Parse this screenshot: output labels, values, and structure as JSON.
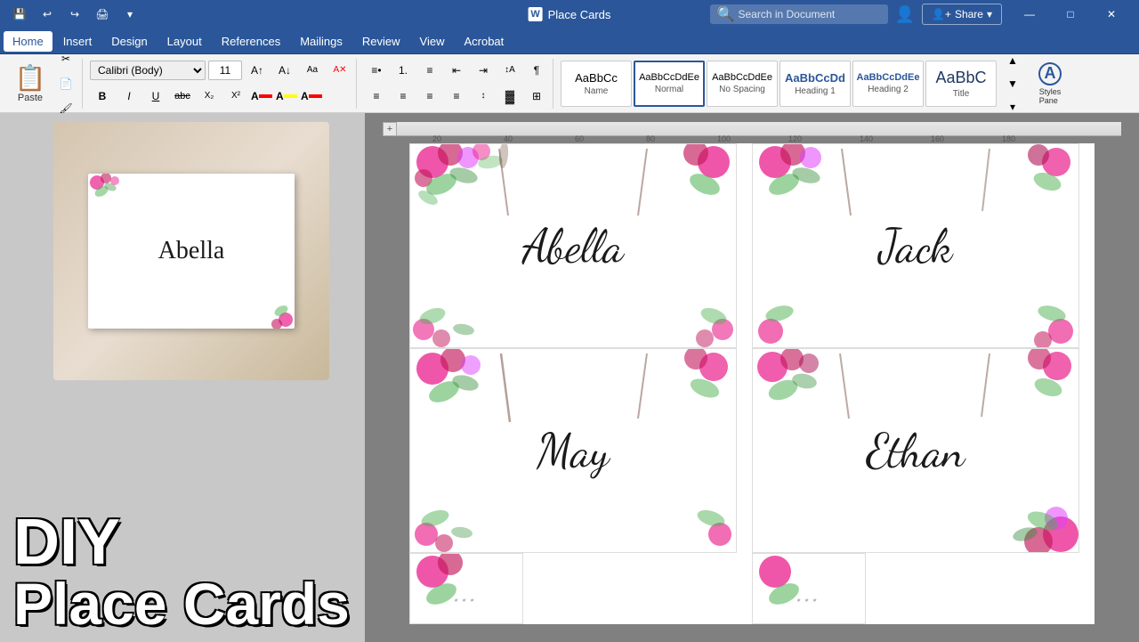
{
  "titlebar": {
    "app_name": "Place Cards",
    "word_icon": "W",
    "search_placeholder": "Search in Document",
    "share_label": "Share",
    "profile_icon": "👤"
  },
  "menubar": {
    "items": [
      "Home",
      "Insert",
      "Design",
      "Layout",
      "References",
      "Mailings",
      "Review",
      "View",
      "Acrobat"
    ]
  },
  "toolbar": {
    "paste_label": "Paste",
    "font_name": "Calibri (Body)",
    "font_size": "11",
    "bold": "B",
    "italic": "I",
    "underline": "U",
    "strikethrough": "abc",
    "subscript": "X₂",
    "superscript": "X²"
  },
  "styles": [
    {
      "id": "name",
      "preview": "AaBbCc",
      "label": "Name"
    },
    {
      "id": "normal",
      "preview": "AaBbCcDdEe",
      "label": "Normal",
      "selected": true
    },
    {
      "id": "no-spacing",
      "preview": "AaBbCcDdEe",
      "label": "No Spacing"
    },
    {
      "id": "heading1",
      "preview": "AaBbCcDd",
      "label": "Heading 1"
    },
    {
      "id": "heading2",
      "preview": "AaBbCcDdEe",
      "label": "Heading 2"
    },
    {
      "id": "title",
      "preview": "AaBbC",
      "label": "Title"
    }
  ],
  "overlay": {
    "line1": "DIY",
    "line2": "Place Cards"
  },
  "place_cards": [
    {
      "name": "Abella",
      "row": 0,
      "col": 0
    },
    {
      "name": "Jack",
      "row": 0,
      "col": 1
    },
    {
      "name": "May",
      "row": 1,
      "col": 0
    },
    {
      "name": "Ethan",
      "row": 1,
      "col": 1
    },
    {
      "name": "...",
      "row": 2,
      "col": 0
    },
    {
      "name": "...",
      "row": 2,
      "col": 1
    }
  ],
  "colors": {
    "ribbon": "#2b579a",
    "toolbar_bg": "#f3f3f3",
    "panel_bg": "#c8c8c8",
    "doc_bg": "#808080",
    "accent": "#2b579a"
  },
  "ruler": {
    "marks": [
      "20",
      "40",
      "60",
      "80",
      "100",
      "120",
      "140",
      "160",
      "180"
    ]
  }
}
